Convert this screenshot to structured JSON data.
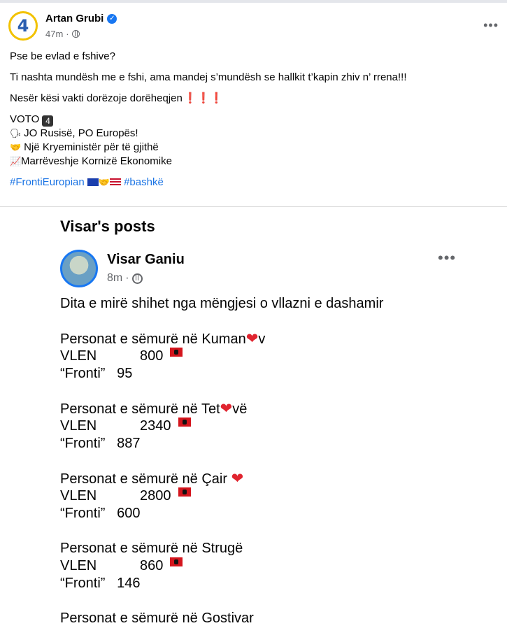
{
  "post": {
    "avatar_text": "4",
    "author": "Artan Grubi",
    "time": "47m",
    "more": "•••",
    "lines": [
      "Pse be evlad e fshive?",
      "Ti nashta mundësh me e fshi, ama mandej s’mundësh se hallkit t’kapin zhiv n’ rrena!!!",
      "Nesër kësi vakti dorëzoje dorëheqjen"
    ],
    "exclaims": "❗❗❗",
    "voto": "VOTO",
    "voto_badge": "4",
    "bullets": [
      {
        "icon": "🗣",
        "text": "JO Rusisë, PO Europës!"
      },
      {
        "icon": "🤝",
        "text": "Një Kryeministër për të gjithë"
      },
      {
        "icon": "📈",
        "text": "Marrëveshje Kornizë Ekonomike"
      }
    ],
    "hashtag1": "#FrontiEuropian",
    "hashtag2": "#bashkë"
  },
  "screenshot": {
    "title": "Visar's posts",
    "author": "Visar Ganiu",
    "time": "8m",
    "more": "•••",
    "greeting": "Dita e mirë shihet nga mëngjesi o vllazni e dashamir",
    "blocks": [
      {
        "head_a": "Personat e sëmurë në Kuman",
        "head_b": "v",
        "vlen": "800",
        "fronti": "95"
      },
      {
        "head_a": "Personat e sëmurë në Tet",
        "head_b": "vë",
        "vlen": "2340",
        "fronti": "887"
      },
      {
        "head_a": "Personat e sëmurë në Çair ",
        "head_b": "",
        "vlen": "2800",
        "fronti": "600"
      },
      {
        "head_a": "Personat e sëmurë në Strugë",
        "head_b": "",
        "vlen": "860",
        "fronti": "146"
      },
      {
        "head_a": "Personat e sëmurë në Gostivar",
        "head_b": "",
        "vlen": "",
        "fronti": ""
      }
    ],
    "vlen_label": "VLEN",
    "fronti_label": "“Fronti”"
  }
}
